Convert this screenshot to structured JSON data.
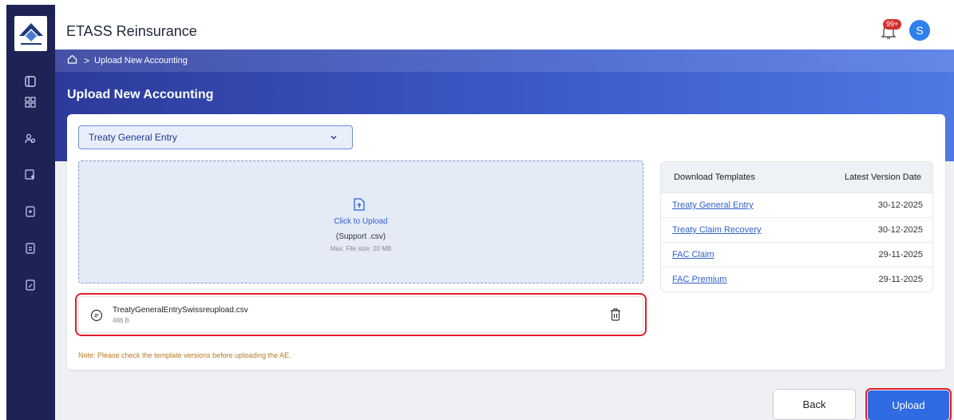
{
  "header": {
    "app_title": "ETASS Reinsurance",
    "notification_badge": "99+",
    "avatar_initial": "S"
  },
  "breadcrumb": {
    "current": "Upload New Accounting"
  },
  "page": {
    "title": "Upload New Accounting"
  },
  "entry_type_select": {
    "selected": "Treaty General Entry"
  },
  "dropzone": {
    "cta": "Click to Upload",
    "support": "(Support .csv)",
    "max_size": "Max. File size: 20 MB"
  },
  "uploaded_file": {
    "name": "TreatyGeneralEntrySwissreupload.csv",
    "size": "486 B"
  },
  "note": "Note: Please check the template versions before uploading the AE.",
  "templates": {
    "headers": {
      "name": "Download Templates",
      "date": "Latest Version Date"
    },
    "rows": [
      {
        "name": "Treaty General Entry",
        "date": "30-12-2025"
      },
      {
        "name": "Treaty Claim Recovery",
        "date": "30-12-2025"
      },
      {
        "name": "FAC Claim",
        "date": "29-11-2025"
      },
      {
        "name": "FAC Premium",
        "date": "29-11-2025"
      }
    ]
  },
  "actions": {
    "back": "Back",
    "upload": "Upload"
  },
  "colors": {
    "sidebar": "#1e2356",
    "accent": "#2f6be3",
    "highlight": "#e11d2a",
    "note": "#b7791f"
  }
}
